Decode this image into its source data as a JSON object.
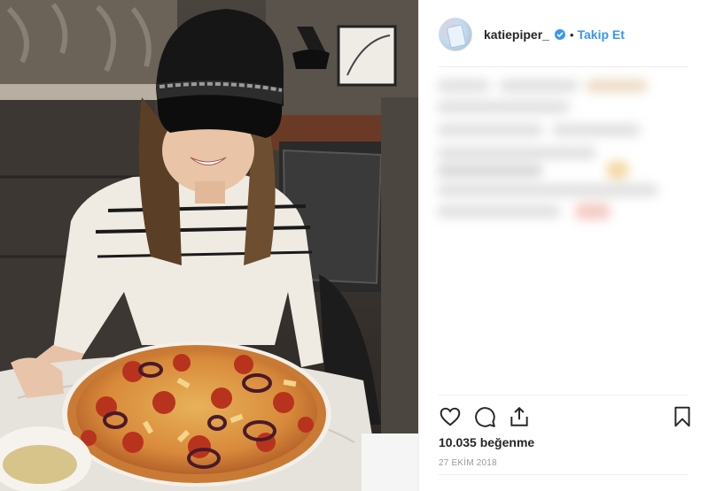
{
  "post": {
    "username": "katiepiper_",
    "separator": "•",
    "follow_label": "Takip Et",
    "likes": "10.035 beğenme",
    "date": "27 EKİM 2018"
  },
  "actions": {
    "like": "heart-icon",
    "comment": "comment-icon",
    "share": "share-icon",
    "save": "bookmark-icon"
  },
  "colors": {
    "accent": "#3897f0",
    "text": "#262626",
    "muted": "#999999",
    "border": "#efefef"
  }
}
